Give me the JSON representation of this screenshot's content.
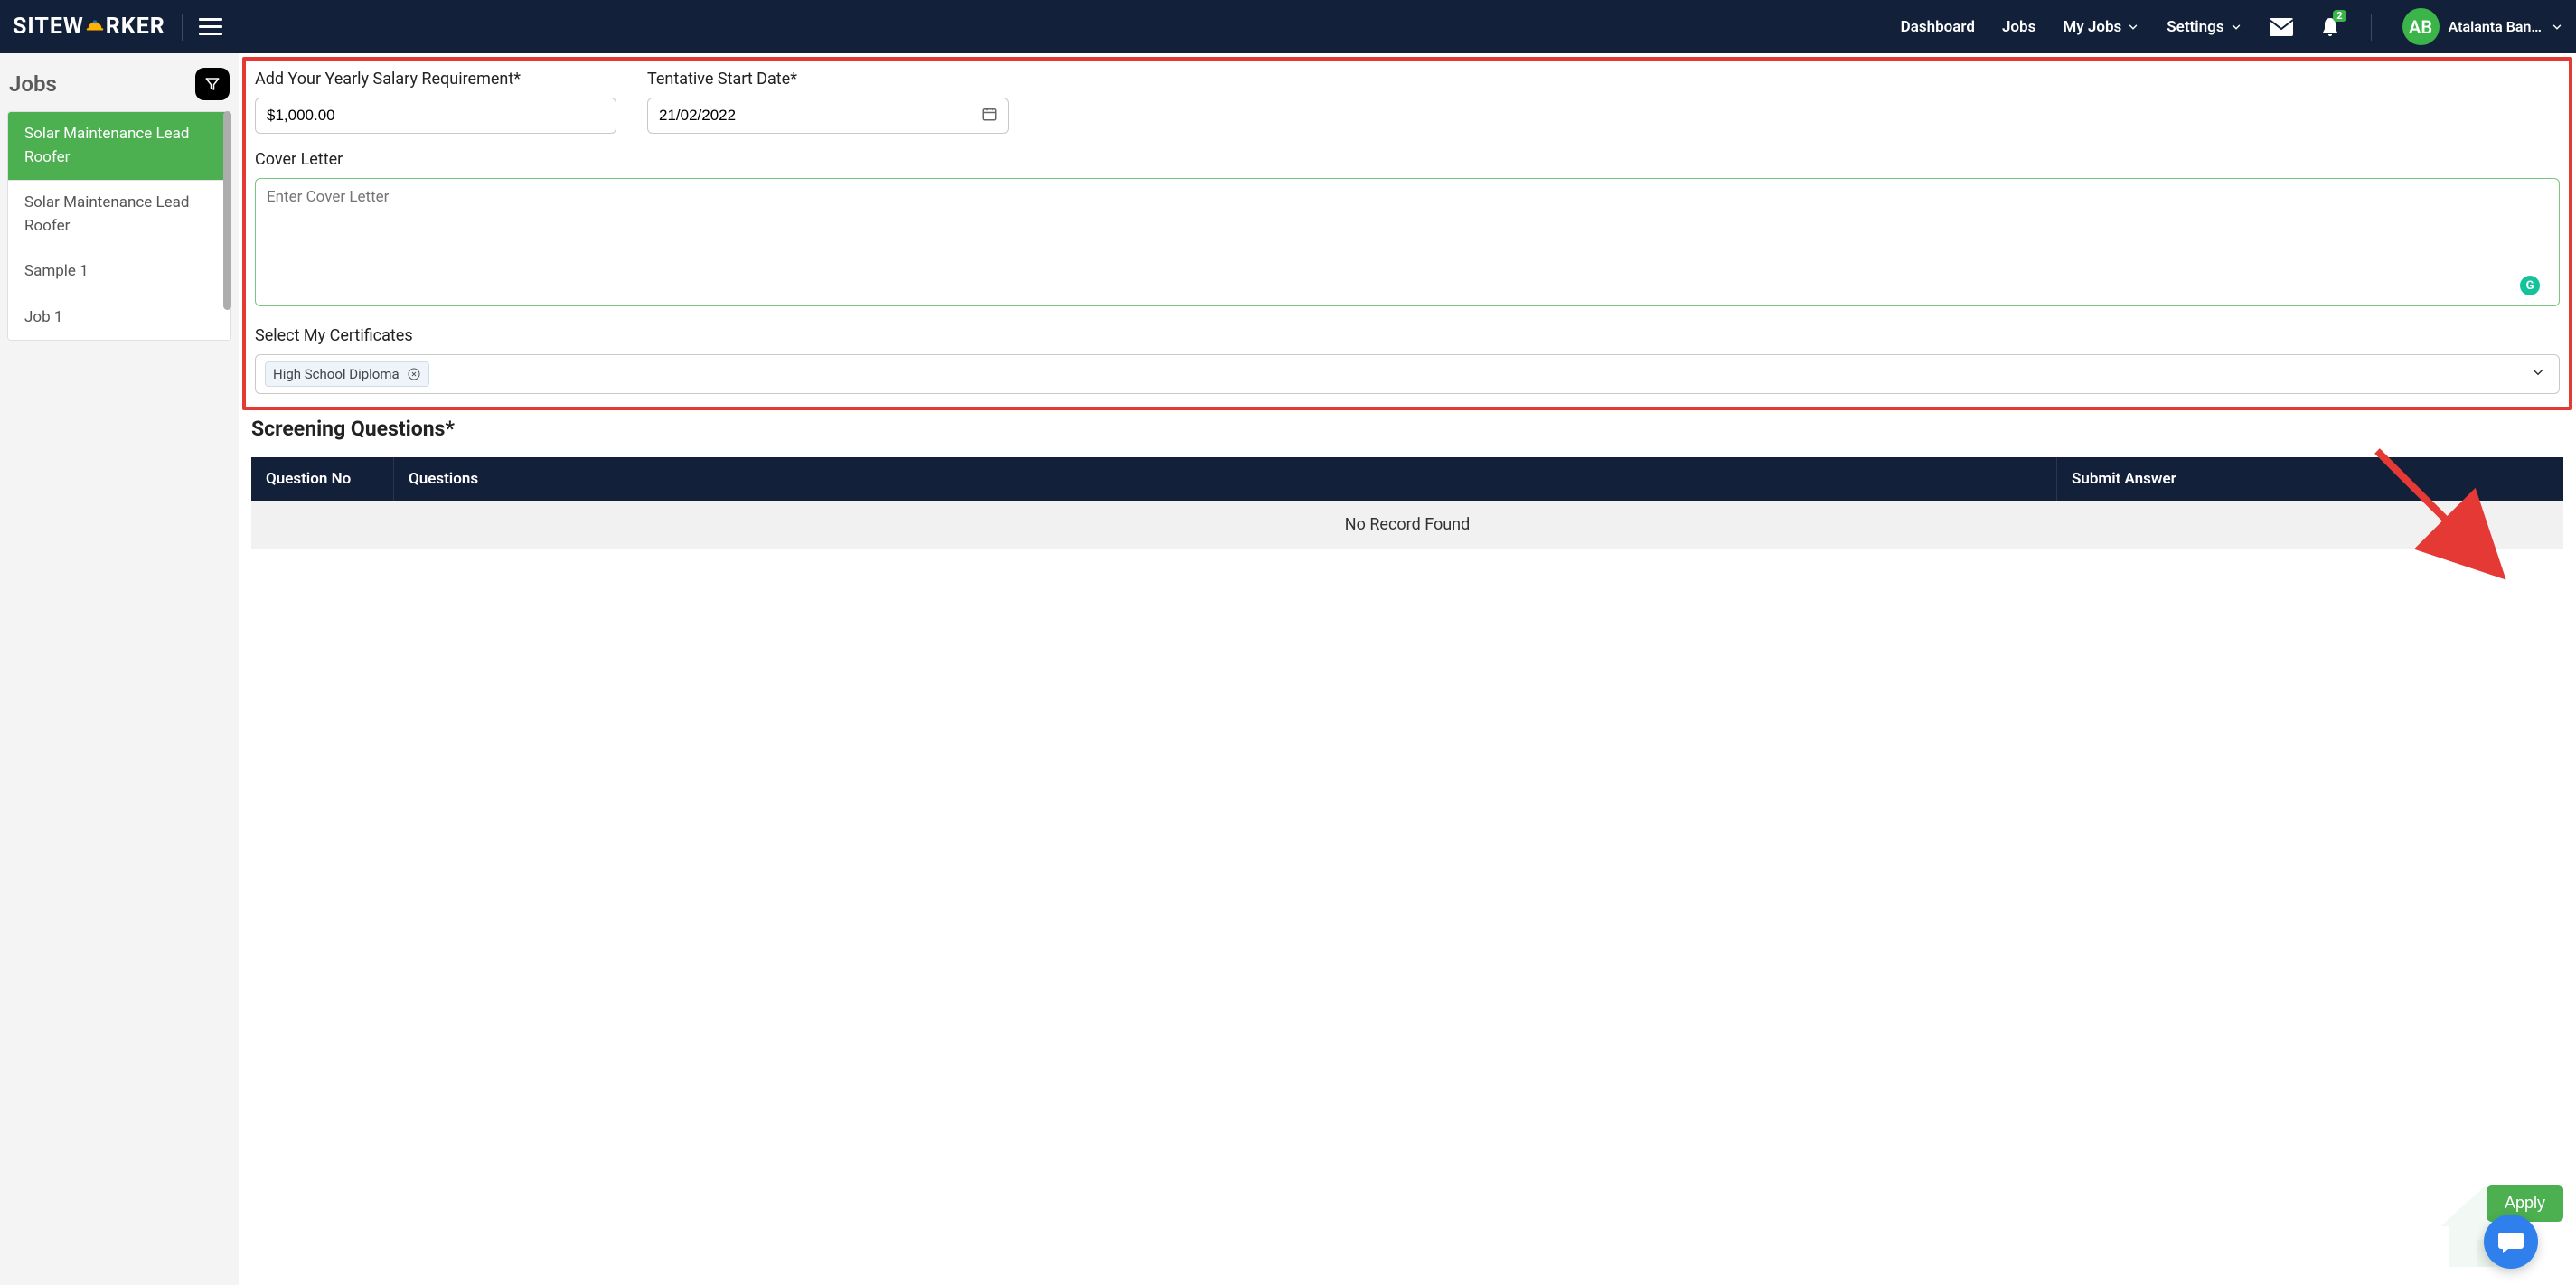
{
  "header": {
    "logo_pre": "SITEW",
    "logo_post": "RKER",
    "nav": {
      "dashboard": "Dashboard",
      "jobs": "Jobs",
      "my_jobs": "My Jobs",
      "settings": "Settings"
    },
    "notifications_badge": "2",
    "avatar_initials": "AB",
    "user_name": "Atalanta Ban…"
  },
  "sidebar": {
    "title": "Jobs",
    "items": [
      {
        "label": "Solar Maintenance Lead Roofer",
        "active": true
      },
      {
        "label": "Solar Maintenance Lead Roofer",
        "active": false
      },
      {
        "label": "Sample 1",
        "active": false
      },
      {
        "label": "Job 1",
        "active": false
      }
    ]
  },
  "form": {
    "salary_label": "Add Your Yearly Salary Requirement*",
    "salary_value": "$1,000.00",
    "date_label": "Tentative Start Date*",
    "date_value": "21/02/2022",
    "cover_label": "Cover Letter",
    "cover_placeholder": "Enter Cover Letter",
    "cert_label": "Select My Certificates",
    "cert_chip": "High School Diploma"
  },
  "screening": {
    "title": "Screening Questions*",
    "cols": {
      "c1": "Question No",
      "c2": "Questions",
      "c3": "Submit Answer"
    },
    "empty": "No Record Found"
  },
  "apply_label": "Apply",
  "grammarly_letter": "G"
}
